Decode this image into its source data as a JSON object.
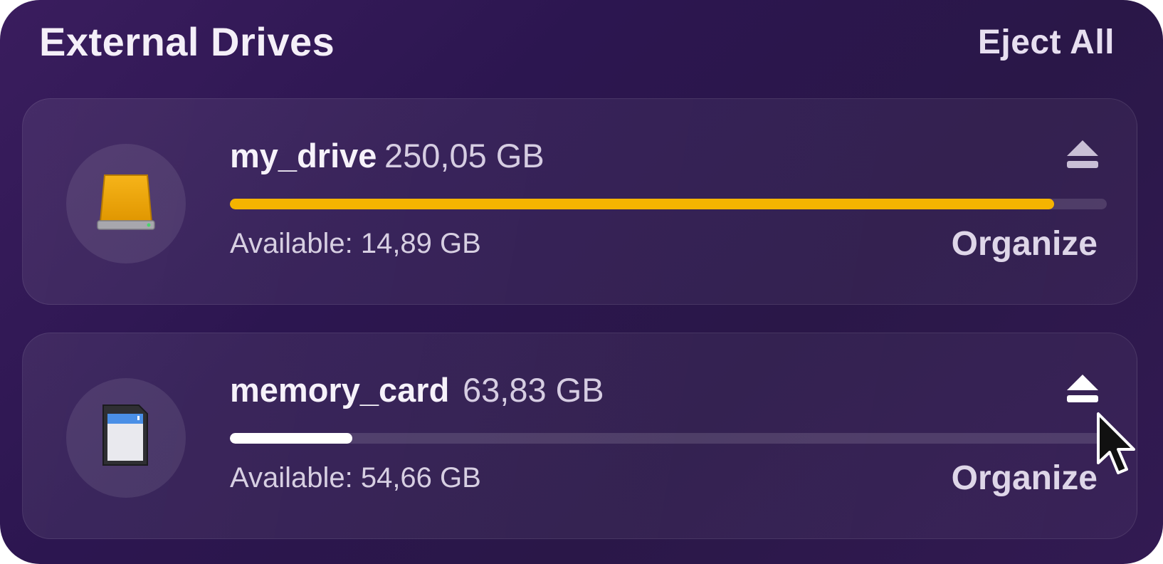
{
  "header": {
    "title": "External Drives",
    "eject_all_label": "Eject All"
  },
  "drives": [
    {
      "name": "my_drive",
      "size": "250,05 GB",
      "available": "Available: 14,89 GB",
      "used_fraction": 0.94,
      "bar_color": "#f5b400",
      "icon": "hard-drive-icon",
      "organize_label": "Organize"
    },
    {
      "name": "memory_card",
      "size": "63,83 GB",
      "available": "Available: 54,66 GB",
      "used_fraction": 0.14,
      "bar_color": "#ffffff",
      "icon": "sd-card-icon",
      "organize_label": "Organize"
    }
  ],
  "colors": {
    "panel_background": "#2c1650",
    "accent_drive": "#f5b400"
  }
}
